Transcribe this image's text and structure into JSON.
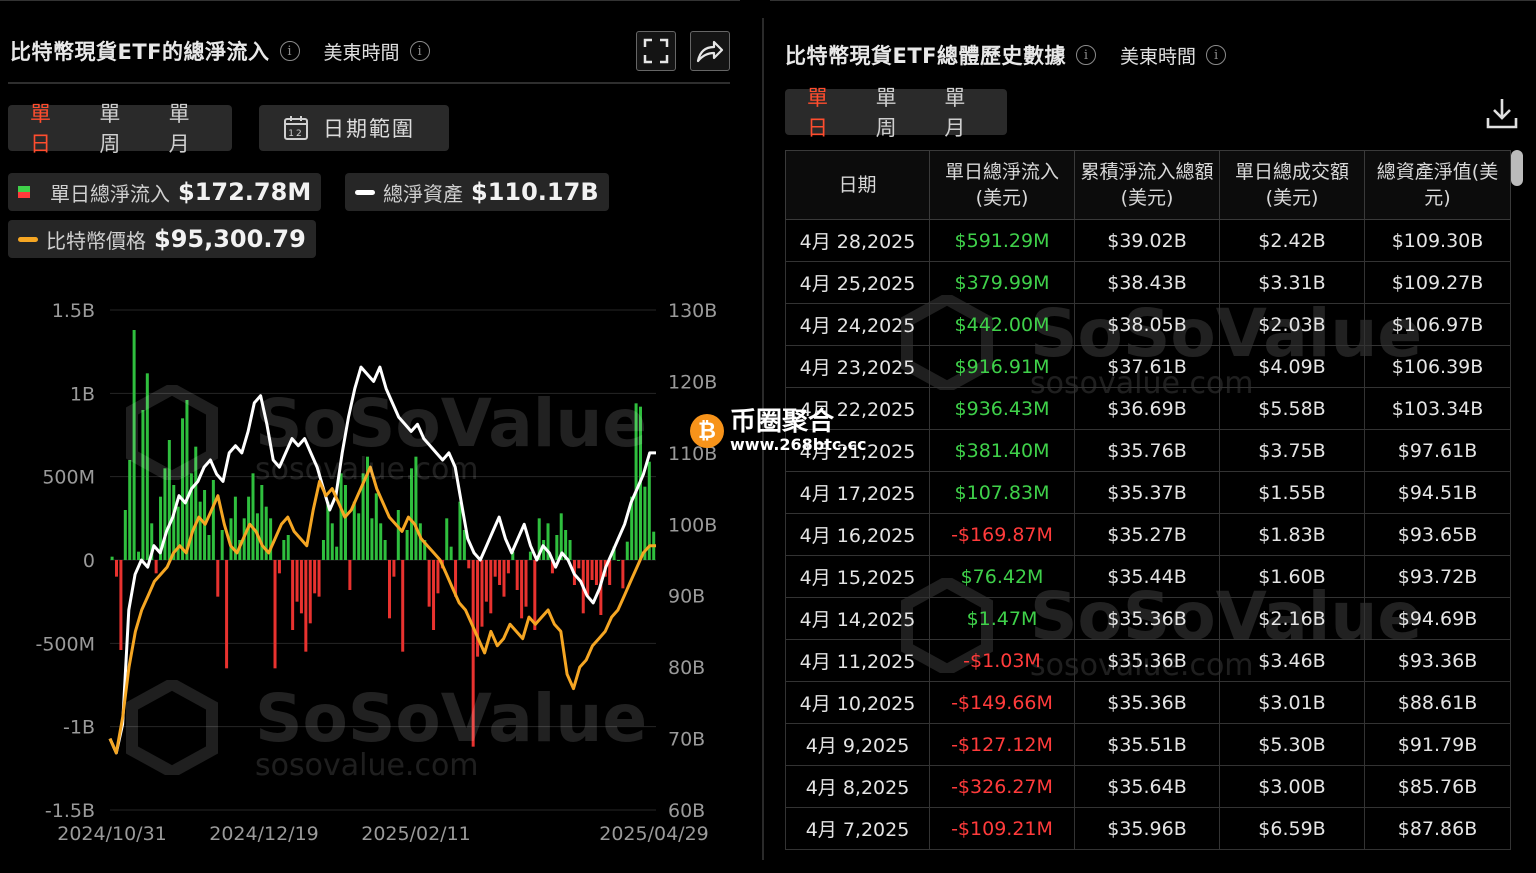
{
  "left": {
    "title": "比特幣現貨ETF的總淨流入",
    "timezone": "美東時間",
    "period_tabs": [
      "單日",
      "單周",
      "單月"
    ],
    "active_tab": "單日",
    "date_range_label": "日期範圍",
    "calendar_day": "12",
    "legend": {
      "inflow_label": "單日總淨流入",
      "inflow_value": "$172.78M",
      "assets_label": "總淨資產",
      "assets_value": "$110.17B",
      "price_label": "比特幣價格",
      "price_value": "$95,300.79"
    },
    "icons": [
      "fullscreen-icon",
      "share-icon",
      "calendar-icon",
      "info-icon"
    ]
  },
  "right": {
    "title": "比特幣現貨ETF總體歷史數據",
    "timezone": "美東時間",
    "period_tabs": [
      "單日",
      "單周",
      "單月"
    ],
    "active_tab": "單日",
    "columns": [
      "日期",
      "單日總淨流入(美元)",
      "累積淨流入總額(美元)",
      "單日總成交額(美元)",
      "總資產淨值(美元)"
    ],
    "rows": [
      [
        "4月 28,2025",
        "$591.29M",
        "$39.02B",
        "$2.42B",
        "$109.30B"
      ],
      [
        "4月 25,2025",
        "$379.99M",
        "$38.43B",
        "$3.31B",
        "$109.27B"
      ],
      [
        "4月 24,2025",
        "$442.00M",
        "$38.05B",
        "$2.03B",
        "$106.97B"
      ],
      [
        "4月 23,2025",
        "$916.91M",
        "$37.61B",
        "$4.09B",
        "$106.39B"
      ],
      [
        "4月 22,2025",
        "$936.43M",
        "$36.69B",
        "$5.58B",
        "$103.34B"
      ],
      [
        "4月 21,2025",
        "$381.40M",
        "$35.76B",
        "$3.75B",
        "$97.61B"
      ],
      [
        "4月 17,2025",
        "$107.83M",
        "$35.37B",
        "$1.55B",
        "$94.51B"
      ],
      [
        "4月 16,2025",
        "-$169.87M",
        "$35.27B",
        "$1.83B",
        "$93.65B"
      ],
      [
        "4月 15,2025",
        "$76.42M",
        "$35.44B",
        "$1.60B",
        "$93.72B"
      ],
      [
        "4月 14,2025",
        "$1.47M",
        "$35.36B",
        "$2.16B",
        "$94.69B"
      ],
      [
        "4月 11,2025",
        "-$1.03M",
        "$35.36B",
        "$3.46B",
        "$93.36B"
      ],
      [
        "4月 10,2025",
        "-$149.66M",
        "$35.36B",
        "$3.01B",
        "$88.61B"
      ],
      [
        "4月 9,2025",
        "-$127.12M",
        "$35.51B",
        "$5.30B",
        "$91.79B"
      ],
      [
        "4月 8,2025",
        "-$326.27M",
        "$35.64B",
        "$3.00B",
        "$85.76B"
      ],
      [
        "4月 7,2025",
        "-$109.21M",
        "$35.96B",
        "$6.59B",
        "$87.86B"
      ]
    ],
    "icons": [
      "download-icon",
      "info-icon"
    ]
  },
  "watermark": {
    "brand": "SoSoValue",
    "site": "sosovalue.com"
  },
  "badge": {
    "title": "币圈聚合",
    "url": "www.268btc.cc",
    "coin_symbol": "₿"
  },
  "colors": {
    "positive": "#3fd14a",
    "negative": "#ff3b3b",
    "price_line": "#f5a623",
    "assets_line": "#ffffff",
    "active_tab": "#ff4d2e"
  },
  "chart_data": {
    "type": "bar",
    "x_tick_labels": [
      "2024/10/31",
      "2024/12/19",
      "2025/02/11",
      "2025/04/29"
    ],
    "y_left_ticks": [
      "1.5B",
      "1B",
      "500M",
      "0",
      "-500M",
      "-1B",
      "-1.5B"
    ],
    "y_left_range": [
      -1.5,
      1.5
    ],
    "y_left_unit": "B USD",
    "y_right_ticks": [
      "130B",
      "120B",
      "110B",
      "100B",
      "90B",
      "80B",
      "70B",
      "60B"
    ],
    "y_right_range": [
      60,
      130
    ],
    "series": [
      {
        "name": "單日總淨流入",
        "kind": "bar",
        "values": [
          0.02,
          -0.1,
          -0.54,
          0.3,
          0.6,
          1.38,
          0.05,
          0.9,
          1.12,
          0.22,
          -0.08,
          0.38,
          0.55,
          0.72,
          0.45,
          0.32,
          0.85,
          0.96,
          0.52,
          0.68,
          0.35,
          0.42,
          0.15,
          0.48,
          -0.22,
          0.18,
          -0.65,
          0.25,
          0.38,
          0.12,
          0.25,
          0.38,
          0.52,
          0.28,
          0.45,
          0.32,
          0.25,
          -0.65,
          -0.08,
          0.12,
          0.15,
          -0.42,
          -0.25,
          -0.32,
          -0.55,
          -0.38,
          -0.2,
          -0.22,
          0.12,
          0.35,
          0.22,
          0.08,
          0.52,
          0.45,
          -0.18,
          0.35,
          0.28,
          0.52,
          0.62,
          0.25,
          0.4,
          0.22,
          0.12,
          -0.35,
          -0.1,
          0.3,
          -0.55,
          0.18,
          0.55,
          0.62,
          0.22,
          0.12,
          -0.28,
          -0.42,
          -0.2,
          -0.05,
          0.25,
          0.08,
          -0.22,
          0.35,
          0.18,
          -0.05,
          -1.12,
          -0.58,
          -0.4,
          -0.25,
          -0.32,
          -0.1,
          -0.15,
          -0.22,
          -0.08,
          0.05,
          -0.18,
          -0.35,
          -0.28,
          0.05,
          -0.42,
          0.25,
          0.12,
          0.22,
          -0.08,
          0.15,
          0.28,
          0.18,
          0.12,
          -0.15,
          -0.05,
          -0.32,
          -0.22,
          -0.12,
          -0.15,
          -0.33,
          -0.1,
          -0.15,
          0.08,
          0.0,
          -0.17,
          0.11,
          0.38,
          0.94,
          0.92,
          0.44,
          0.59,
          0.17
        ]
      },
      {
        "name": "總淨資產",
        "kind": "line",
        "axis": "right",
        "values": [
          70,
          68,
          72,
          88,
          93,
          95,
          94,
          97,
          96,
          99,
          101,
          104,
          103,
          105,
          106,
          108,
          109,
          107,
          106,
          110,
          111,
          110,
          113,
          117,
          118,
          114,
          109,
          108,
          110,
          112,
          111,
          112,
          110,
          108,
          105,
          102,
          104,
          110,
          115,
          119,
          122,
          121,
          120,
          122,
          119,
          117,
          115,
          114,
          113,
          114,
          112,
          111,
          110,
          109,
          110,
          108,
          103,
          98,
          96,
          95,
          97,
          99,
          101,
          98,
          96,
          98,
          100,
          97,
          95,
          97,
          96,
          94,
          96,
          95,
          93,
          92,
          90,
          89,
          91,
          94,
          96,
          98,
          100,
          103,
          105,
          107,
          110,
          110
        ]
      },
      {
        "name": "比特幣價格",
        "kind": "line",
        "axis": "right",
        "values": [
          70,
          68,
          73,
          80,
          85,
          88,
          90,
          92,
          93,
          94,
          96,
          97,
          96,
          99,
          101,
          100,
          102,
          104,
          100,
          97,
          96,
          98,
          100,
          99,
          97,
          96,
          98,
          100,
          101,
          99,
          98,
          97,
          102,
          106,
          104,
          105,
          103,
          101,
          102,
          104,
          106,
          108,
          105,
          103,
          101,
          100,
          99,
          101,
          100,
          98,
          97,
          96,
          95,
          93,
          91,
          89,
          88,
          86,
          84,
          82,
          85,
          83,
          84,
          86,
          85,
          84,
          87,
          86,
          87,
          88,
          86,
          85,
          79,
          77,
          80,
          81,
          83,
          84,
          85,
          87,
          88,
          90,
          92,
          94,
          96,
          97,
          97
        ]
      }
    ]
  }
}
